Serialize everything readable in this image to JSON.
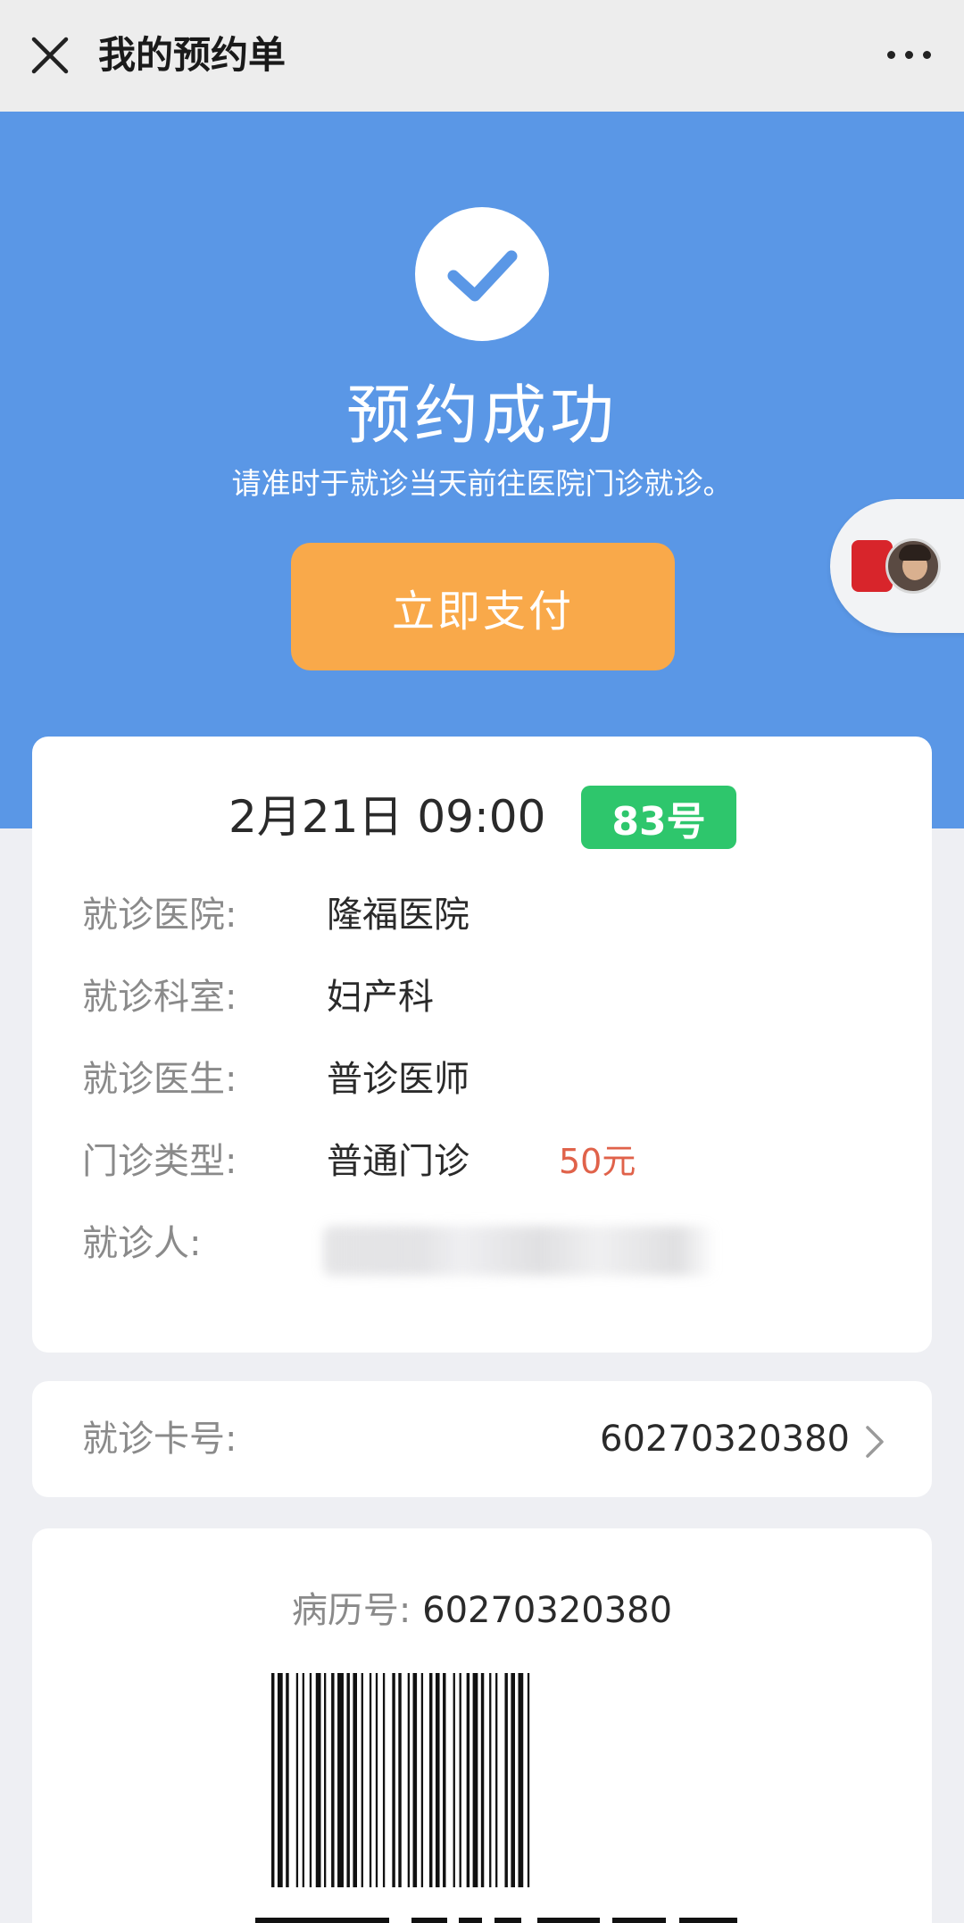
{
  "nav": {
    "title": "我的预约单",
    "close_icon": "close-icon",
    "more_icon": "more-icon"
  },
  "hero": {
    "status_icon": "check-circle-icon",
    "title": "预约成功",
    "subtitle": "请准时于就诊当天前往医院门诊就诊。",
    "pay_button": "立即支付",
    "floating_widget_icon": "avatar-icon"
  },
  "appointment": {
    "datetime": "2月21日 09:00",
    "queue_number": "83号",
    "rows": [
      {
        "label": "就诊医院:",
        "value": "隆福医院"
      },
      {
        "label": "就诊科室:",
        "value": "妇产科"
      },
      {
        "label": "就诊医生:",
        "value": "普诊医师"
      },
      {
        "label": "门诊类型:",
        "value": "普通门诊",
        "fee": "50元"
      },
      {
        "label": "就诊人:",
        "value": ""
      }
    ]
  },
  "medical_card": {
    "label": "就诊卡号:",
    "value": "60270320380",
    "chevron_icon": "chevron-right-icon"
  },
  "record": {
    "label": "病历号:",
    "value": "60270320380",
    "barcode_icon": "barcode-icon"
  },
  "colors": {
    "accent": "#5a97e6",
    "pay_button": "#f9a94a",
    "badge_green": "#2ec66c",
    "fee_red": "#e0624a",
    "background": "#eeeff3"
  }
}
